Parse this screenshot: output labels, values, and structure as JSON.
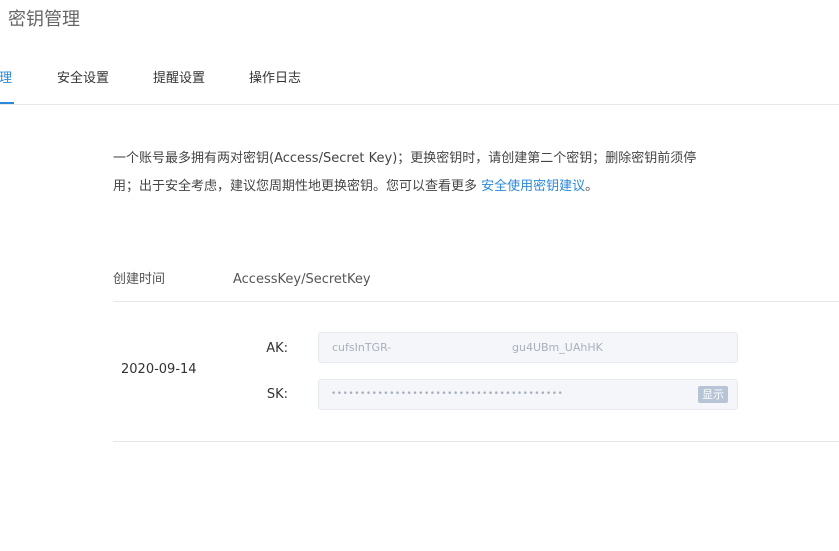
{
  "page": {
    "title": "密钥管理"
  },
  "tabs": [
    {
      "label": "管理",
      "active": true
    },
    {
      "label": "安全设置",
      "active": false
    },
    {
      "label": "提醒设置",
      "active": false
    },
    {
      "label": "操作日志",
      "active": false
    }
  ],
  "notice": {
    "line1": "一个账号最多拥有两对密钥(Access/Secret Key)；更换密钥时，请创建第二个密钥；删除密钥前须停",
    "line2_prefix": "用；出于安全考虑，建议您周期性地更换密钥。您可以查看更多 ",
    "link_text": "安全使用密钥建议",
    "line2_suffix": "。"
  },
  "table": {
    "headers": {
      "created": "创建时间",
      "keys": "AccessKey/SecretKey"
    },
    "rows": [
      {
        "created": "2020-09-14",
        "ak_label": "AK:",
        "ak_part1": "cufsInTGR-",
        "ak_part2": "gu4UBm_UAhHK",
        "sk_label": "SK:",
        "sk_mask": "••••••••••••••••••••••••••••••••••••••••",
        "show_label": "显示"
      }
    ]
  },
  "colors": {
    "accent": "#2a88d8",
    "key_box_bg": "#f4f6f9",
    "show_button_bg": "#b7c4d6"
  }
}
